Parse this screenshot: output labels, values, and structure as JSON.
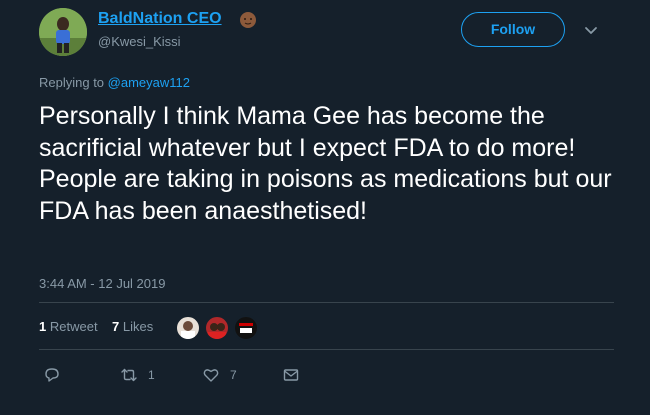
{
  "author": {
    "display_name": "BaldNation CEO",
    "emoji": "dark-skin-bald-man-emoji",
    "handle": "@Kwesi_Kissi"
  },
  "follow_label": "Follow",
  "reply_context": {
    "prefix": "Replying to",
    "mention": "@ameyaw112"
  },
  "tweet_text": "Personally I think Mama Gee has become the sacrificial whatever but I expect FDA to do more! People are taking in poisons as medications but our FDA has been anaesthetised!",
  "timestamp": "3:44 AM - 12 Jul 2019",
  "stats": {
    "retweets_count": "1",
    "retweets_label": "Retweet",
    "likes_count": "7",
    "likes_label": "Likes"
  },
  "actions": {
    "reply_icon": "reply-icon",
    "retweet_icon": "retweet-icon",
    "retweet_count": "1",
    "like_icon": "heart-icon",
    "like_count": "7",
    "dm_icon": "envelope-icon"
  },
  "colors": {
    "background": "#15202b",
    "accent": "#1da1f2",
    "muted": "#8899a6",
    "divider": "#38444d"
  }
}
